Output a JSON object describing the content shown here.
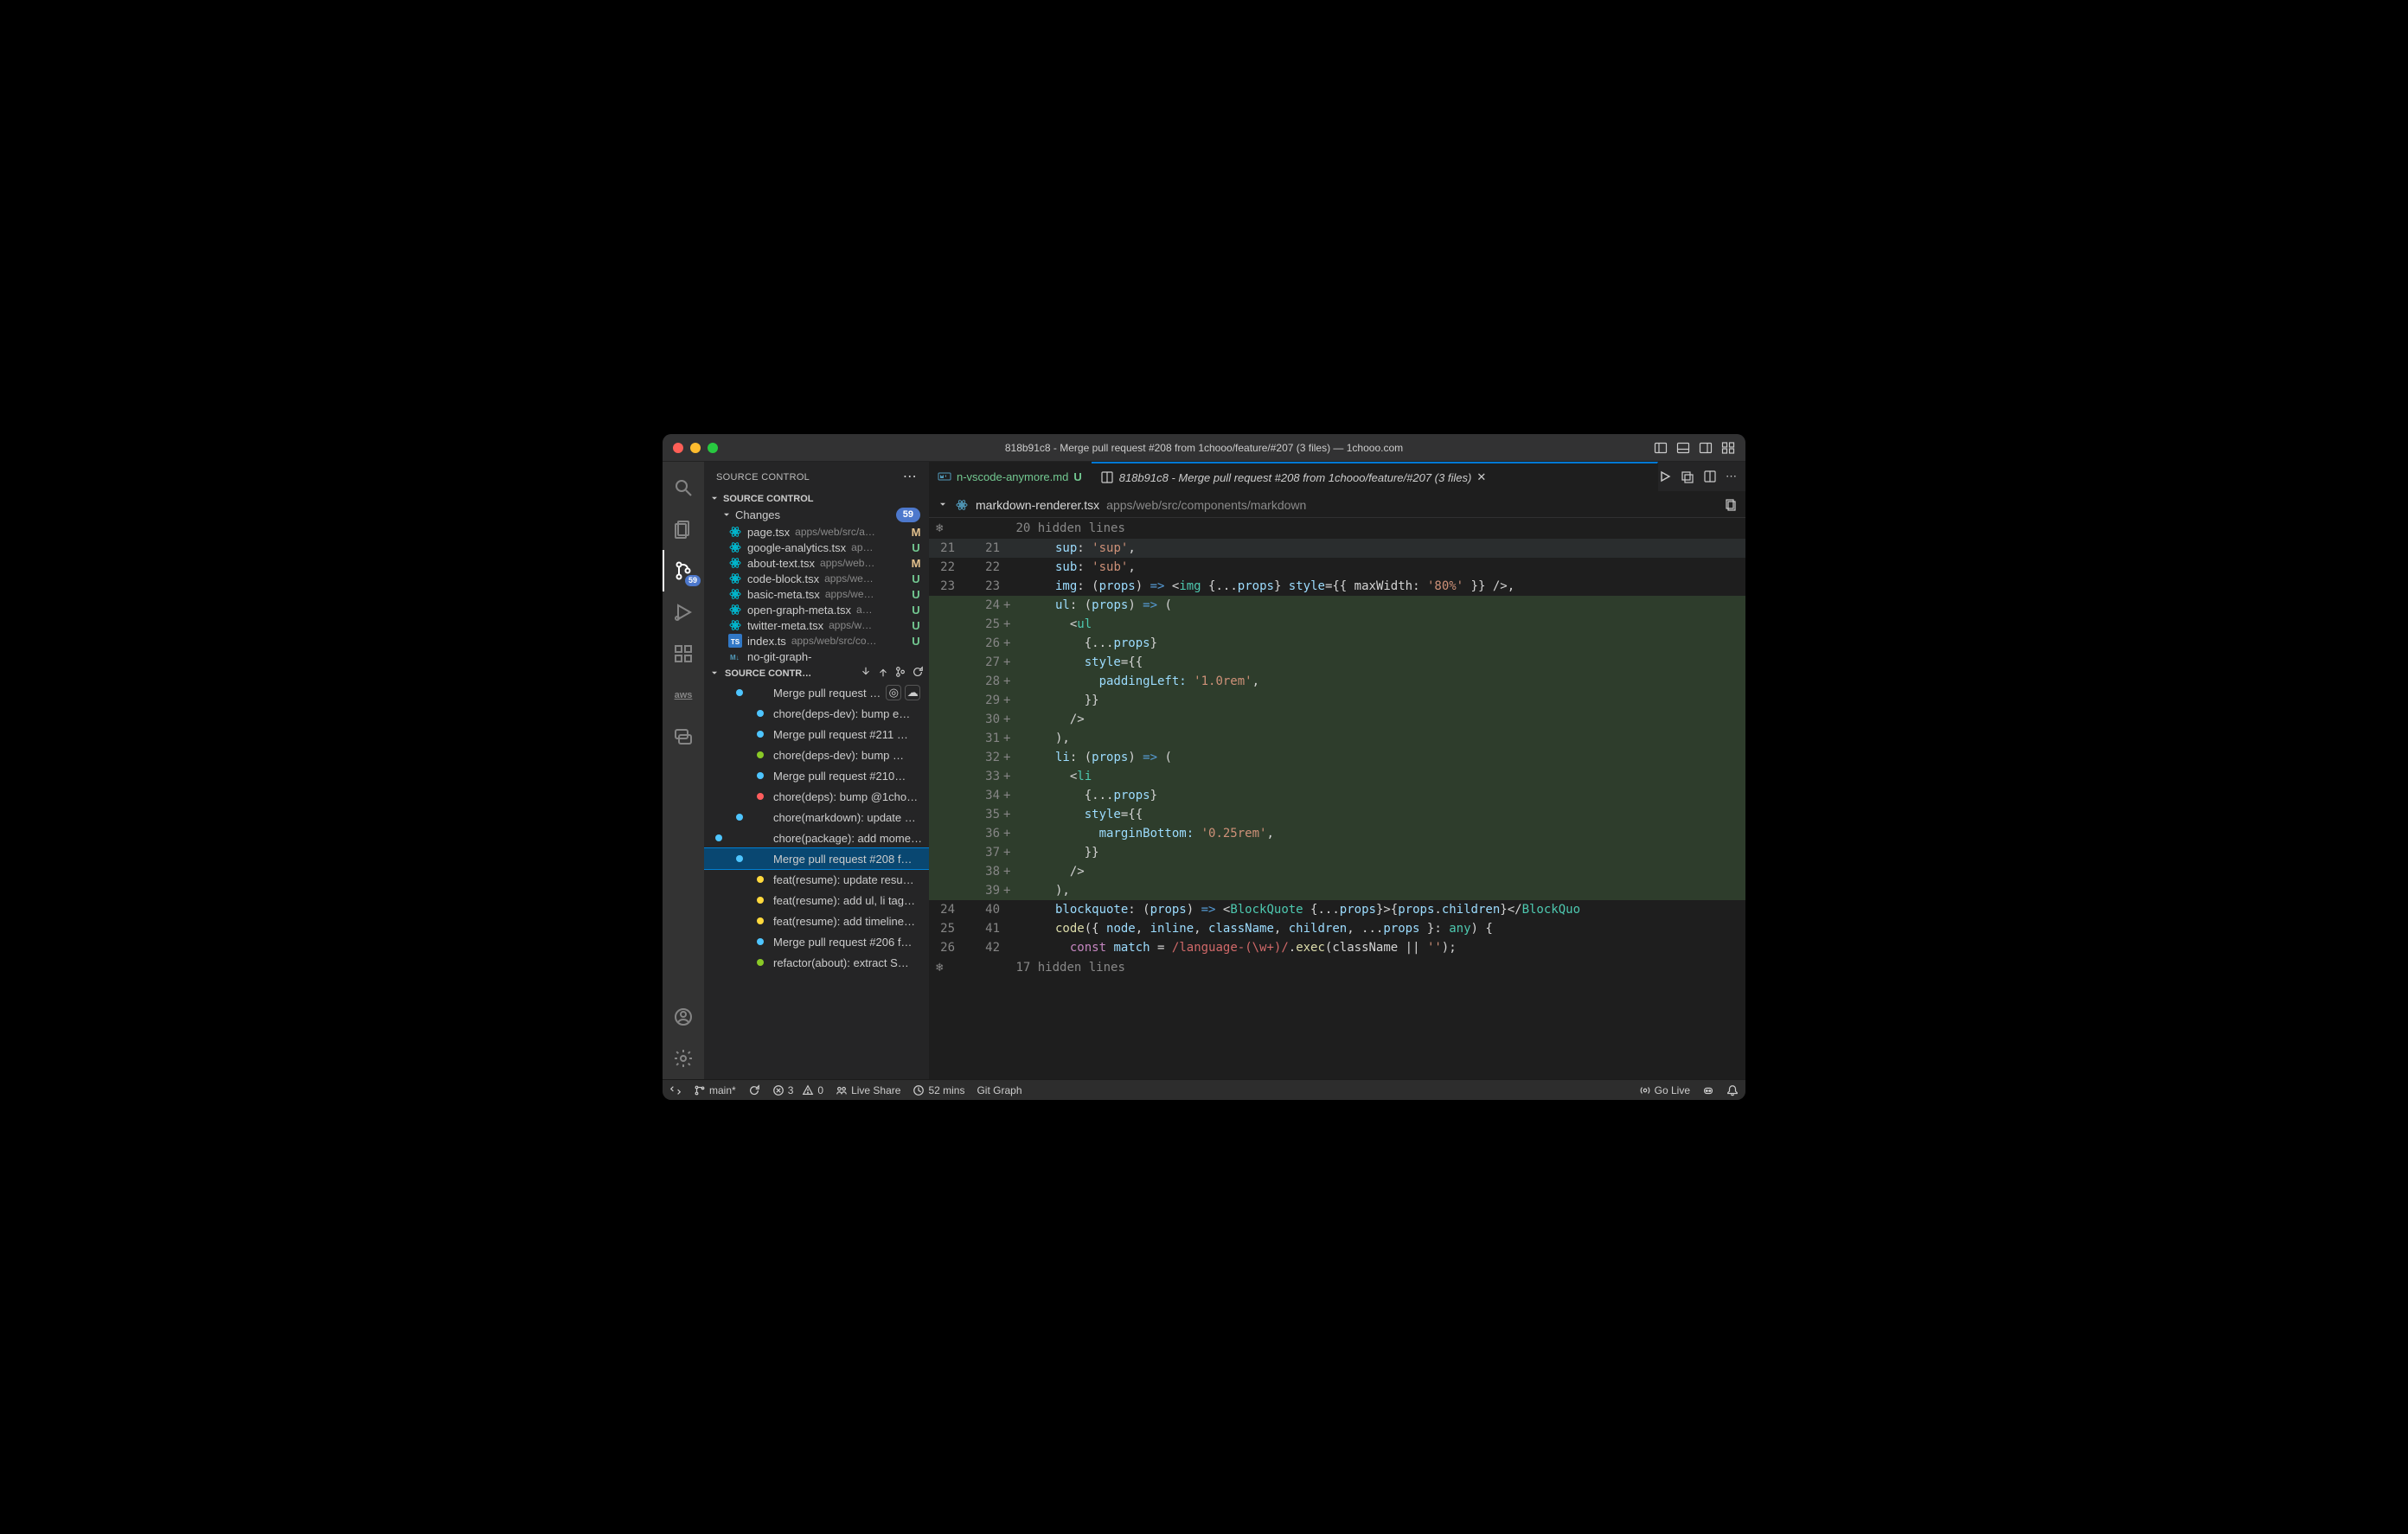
{
  "title": "818b91c8 - Merge pull request #208 from 1chooo/feature/#207 (3 files) — 1chooo.com",
  "sidebar": {
    "header": "SOURCE CONTROL",
    "section": "SOURCE CONTROL",
    "changes_label": "Changes",
    "changes_count": "59",
    "files": [
      {
        "name": "page.tsx",
        "path": "apps/web/src/a…",
        "status": "M",
        "icon": "react"
      },
      {
        "name": "google-analytics.tsx",
        "path": "ap…",
        "status": "U",
        "icon": "react"
      },
      {
        "name": "about-text.tsx",
        "path": "apps/web…",
        "status": "M",
        "icon": "react"
      },
      {
        "name": "code-block.tsx",
        "path": "apps/we…",
        "status": "U",
        "icon": "react"
      },
      {
        "name": "basic-meta.tsx",
        "path": "apps/we…",
        "status": "U",
        "icon": "react"
      },
      {
        "name": "open-graph-meta.tsx",
        "path": "a…",
        "status": "U",
        "icon": "react"
      },
      {
        "name": "twitter-meta.tsx",
        "path": "apps/w…",
        "status": "U",
        "icon": "react"
      },
      {
        "name": "index.ts",
        "path": "apps/web/src/co…",
        "status": "U",
        "icon": "ts"
      },
      {
        "name": "no-git-graph-",
        "path": "",
        "status": "",
        "icon": "md"
      }
    ],
    "graph_section": "SOURCE CONTR…",
    "graph": [
      {
        "label": "Merge pull request …",
        "color": "#4ec5ff",
        "extra": true,
        "col": 1
      },
      {
        "label": "chore(deps-dev): bump e…",
        "color": "#4ec5ff",
        "col": 2
      },
      {
        "label": "Merge pull request #211 …",
        "color": "#4ec5ff",
        "col": 2
      },
      {
        "label": "chore(deps-dev): bump …",
        "color": "#8ac926",
        "col": 2
      },
      {
        "label": "Merge pull request #210…",
        "color": "#4ec5ff",
        "col": 2
      },
      {
        "label": "chore(deps): bump @1cho…",
        "color": "#ff5d5d",
        "col": 2
      },
      {
        "label": "chore(markdown): update …",
        "color": "#4ec5ff",
        "col": 1
      },
      {
        "label": "chore(package): add mome…",
        "color": "#4ec5ff",
        "col": 0
      },
      {
        "label": "Merge pull request #208 f…",
        "color": "#4ec5ff",
        "col": 1,
        "selected": true
      },
      {
        "label": "feat(resume): update resu…",
        "color": "#ffd93d",
        "col": 2
      },
      {
        "label": "feat(resume): add ul, li tag…",
        "color": "#ffd93d",
        "col": 2
      },
      {
        "label": "feat(resume): add timeline…",
        "color": "#ffd93d",
        "col": 2
      },
      {
        "label": "Merge pull request #206 f…",
        "color": "#4ec5ff",
        "col": 2
      },
      {
        "label": "refactor(about): extract S…",
        "color": "#8ac926",
        "col": 2
      }
    ]
  },
  "tabs": {
    "t1": {
      "label": "n-vscode-anymore.md",
      "suffix": "U"
    },
    "t2": {
      "label": "818b91c8 - Merge pull request #208 from 1chooo/feature/#207 (3 files)"
    }
  },
  "breadcrumb": {
    "file": "markdown-renderer.tsx",
    "path": "apps/web/src/components/markdown"
  },
  "folds": {
    "top": "20 hidden lines",
    "bottom": "17 hidden lines"
  },
  "code": {
    "r21a": "21",
    "r21b": "21",
    "r22a": "22",
    "r22b": "22",
    "r23a": "23",
    "r23b": "23",
    "r24b": "24",
    "r25b": "25",
    "r26b": "26",
    "r27b": "27",
    "r28b": "28",
    "r29b": "29",
    "r30b": "30",
    "r31b": "31",
    "r32b": "32",
    "r33b": "33",
    "r34b": "34",
    "r35b": "35",
    "r36b": "36",
    "r37b": "37",
    "r38b": "38",
    "r39b": "39",
    "r40a": "24",
    "r40b": "40",
    "r41a": "25",
    "r41b": "41",
    "r42a": "26",
    "r42b": "42",
    "l21": "sup: 'sup',",
    "l22": "sub: 'sub',",
    "l23_1": "img",
    "l23_2": ": (",
    "l23_3": "props",
    "l23_4": ") ",
    "l23_5": "=>",
    "l23_6": " <",
    "l23_7": "img",
    "l23_8": " {",
    "l23_9": "...",
    "l23_10": "props",
    "l23_11": "} ",
    "l23_12": "style",
    "l23_13": "={{ maxWidth: ",
    "l23_14": "'80%'",
    "l23_15": " }} />,",
    "l24_1": "ul",
    "l24_2": ": (",
    "l24_3": "props",
    "l24_4": ") ",
    "l24_5": "=>",
    "l24_6": " (",
    "l25": "<ul",
    "l26_1": "{",
    "l26_2": "...",
    "l26_3": "props",
    "l26_4": "}",
    "l27_1": "style",
    "l27_2": "={{",
    "l28_1": "paddingLeft: ",
    "l28_2": "'1.0rem'",
    "l28_3": ",",
    "l29": "}}",
    "l30": "/>",
    "l31": "),",
    "l32_1": "li",
    "l32_2": ": (",
    "l32_3": "props",
    "l32_4": ") ",
    "l32_5": "=>",
    "l32_6": " (",
    "l33": "<li",
    "l34_1": "{",
    "l34_2": "...",
    "l34_3": "props",
    "l34_4": "}",
    "l35_1": "style",
    "l35_2": "={{",
    "l36_1": "marginBottom: ",
    "l36_2": "'0.25rem'",
    "l36_3": ",",
    "l37": "}}",
    "l38": "/>",
    "l39": "),",
    "l40_1": "blockquote",
    "l40_2": ": (",
    "l40_3": "props",
    "l40_4": ") ",
    "l40_5": "=>",
    "l40_6": " <",
    "l40_7": "BlockQuote",
    "l40_8": " {",
    "l40_9": "...",
    "l40_10": "props",
    "l40_11": "}>{",
    "l40_12": "props",
    "l40_13": ".",
    "l40_14": "children",
    "l40_15": "}</",
    "l40_16": "BlockQuo",
    "l41_1": "code",
    "l41_2": "({ ",
    "l41_3": "node",
    "l41_4": ", ",
    "l41_5": "inline",
    "l41_6": ", ",
    "l41_7": "className",
    "l41_8": ", ",
    "l41_9": "children",
    "l41_10": ", ",
    "l41_11": "...",
    "l41_12": "props",
    "l41_13": " }: ",
    "l41_14": "any",
    "l41_15": ") {",
    "l42_1": "const",
    "l42_2": " ",
    "l42_3": "match",
    "l42_4": " = ",
    "l42_5": "/language-(\\w+)/",
    "l42_6": ".",
    "l42_7": "exec",
    "l42_8": "(className || ",
    "l42_9": "''",
    "l42_10": ");"
  },
  "status": {
    "branch": "main*",
    "errors": "3",
    "warnings": "0",
    "liveshare": "Live Share",
    "time": "52 mins",
    "gitgraph": "Git Graph",
    "golive": "Go Live"
  },
  "activity_badge": "59"
}
